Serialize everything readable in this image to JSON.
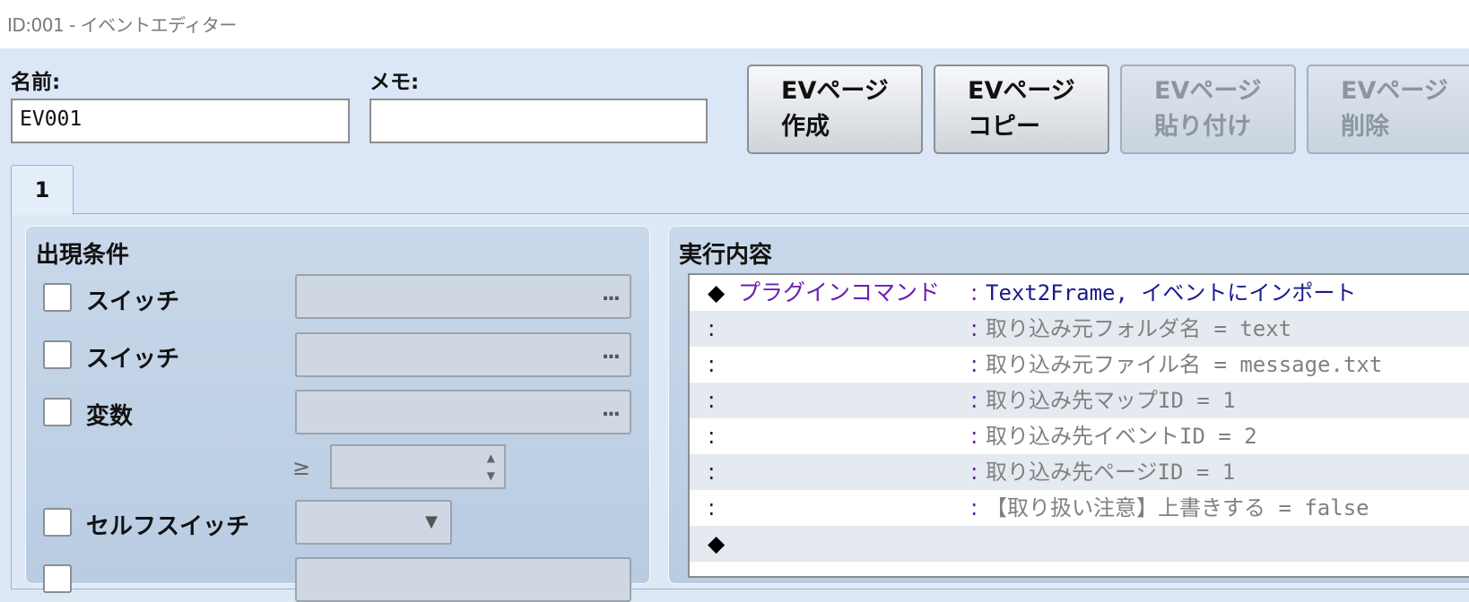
{
  "window": {
    "title": "ID:001 - イベントエディター"
  },
  "header": {
    "name_label": "名前:",
    "name_value": "EV001",
    "memo_label": "メモ:",
    "memo_value": ""
  },
  "page_buttons": [
    {
      "line1": "EVページ",
      "line2": "作成",
      "enabled": true
    },
    {
      "line1": "EVページ",
      "line2": "コピー",
      "enabled": true
    },
    {
      "line1": "EVページ",
      "line2": "貼り付け",
      "enabled": false
    },
    {
      "line1": "EVページ",
      "line2": "削除",
      "enabled": false
    }
  ],
  "tabs": [
    {
      "label": "1"
    }
  ],
  "conditions": {
    "title": "出現条件",
    "switch1_label": "スイッチ",
    "switch2_label": "スイッチ",
    "variable_label": "変数",
    "browse_glyph": "...",
    "ge_symbol": "≥",
    "selfswitch_label": "セルフスイッチ"
  },
  "contents": {
    "title": "実行内容",
    "rows": [
      {
        "lead": "◆",
        "head": "プラグインコマンド",
        "colon": ":",
        "text": "Text2Frame, イベントにインポート",
        "style": "navy"
      },
      {
        "lead": ":",
        "head": "",
        "colon": ":",
        "text": "取り込み元フォルダ名 = text",
        "style": "gray"
      },
      {
        "lead": ":",
        "head": "",
        "colon": ":",
        "text": "取り込み元ファイル名 = message.txt",
        "style": "gray"
      },
      {
        "lead": ":",
        "head": "",
        "colon": ":",
        "text": "取り込み先マップID = 1",
        "style": "gray"
      },
      {
        "lead": ":",
        "head": "",
        "colon": ":",
        "text": "取り込み先イベントID = 2",
        "style": "gray"
      },
      {
        "lead": ":",
        "head": "",
        "colon": ":",
        "text": "取り込み先ページID = 1",
        "style": "gray"
      },
      {
        "lead": ":",
        "head": "",
        "colon": ":",
        "text": "【取り扱い注意】上書きする = false",
        "style": "gray"
      },
      {
        "lead": "◆",
        "head": "",
        "colon": "",
        "text": "",
        "style": "navy"
      }
    ]
  },
  "colors": {
    "background": "#dbe7f6",
    "command_purple": "#6a1fb0",
    "command_navy": "#1a1a8a",
    "param_gray": "#808080"
  }
}
